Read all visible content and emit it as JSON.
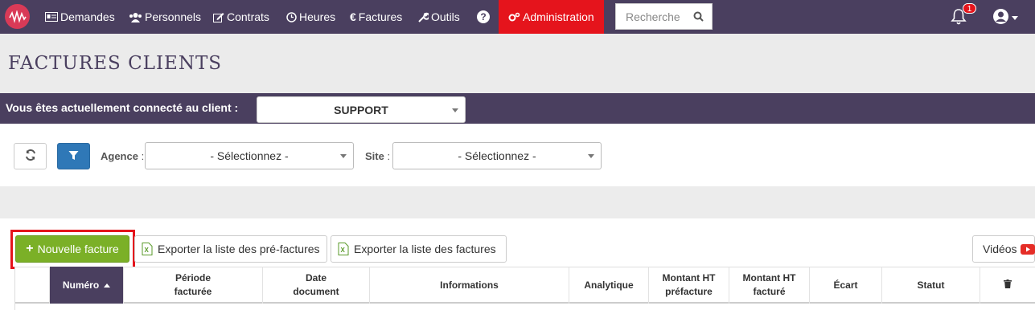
{
  "nav": {
    "items": [
      {
        "label": "Demandes",
        "icon": "id-card-icon"
      },
      {
        "label": "Personnels",
        "icon": "users-icon"
      },
      {
        "label": "Contrats",
        "icon": "edit-icon"
      },
      {
        "label": "Heures",
        "icon": "clock-icon"
      },
      {
        "label": "Factures",
        "icon": "euro-icon"
      },
      {
        "label": "Outils",
        "icon": "wrench-icon"
      }
    ],
    "help_icon": "question-icon",
    "admin_label": "Administration",
    "search_placeholder": "Recherche",
    "notif_count": "1"
  },
  "page": {
    "title": "FACTURES CLIENTS"
  },
  "client": {
    "label": "Vous êtes actuellement connecté au client :",
    "selected": "SUPPORT"
  },
  "filters": {
    "agence_label": "Agence",
    "site_label": "Site",
    "colon": ":",
    "agence_value": "- Sélectionnez -",
    "site_value": "- Sélectionnez -"
  },
  "actions": {
    "new_invoice": "Nouvelle facture",
    "export_pre": "Exporter la liste des pré-factures",
    "export_inv": "Exporter la liste des factures",
    "videos": "Vidéos"
  },
  "table": {
    "headers": [
      "Numéro",
      "Période facturée",
      "Date document",
      "Informations",
      "Analytique",
      "Montant HT préfacture",
      "Montant HT facturé",
      "Écart",
      "Statut"
    ]
  },
  "colors": {
    "nav_bg": "#4a3f5f",
    "admin_bg": "#e5141c",
    "green": "#7bb027",
    "blue": "#2f78b7"
  }
}
